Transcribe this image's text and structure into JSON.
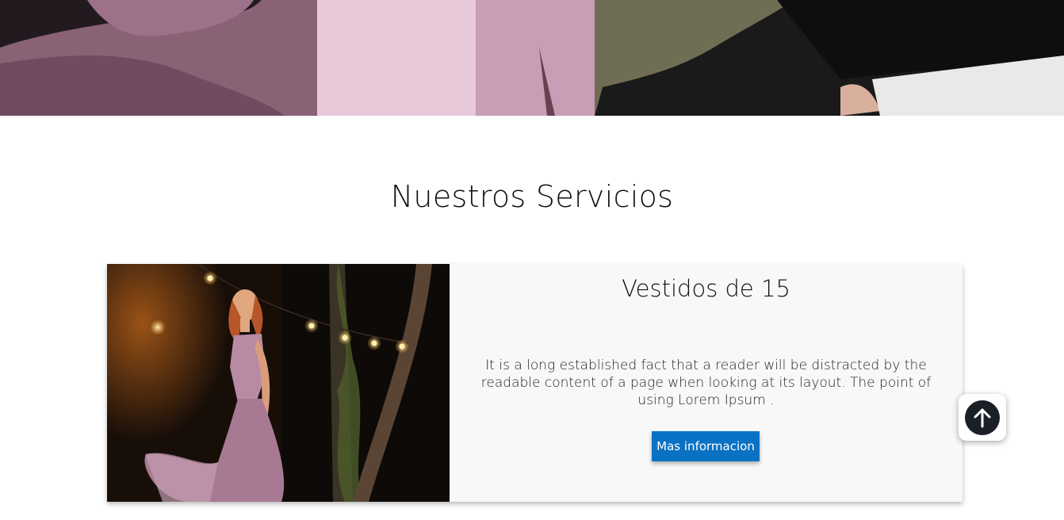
{
  "hero": {
    "image_alt": "banner-dresses-photo"
  },
  "services": {
    "title": "Nuestros Servicios",
    "cards": [
      {
        "image_alt": "quinceanera-dress-photo",
        "title": "Vestidos de 15",
        "text": "It is a long established fact that a reader will be distracted by the readable content of a page when looking at its layout. The point of using Lorem Ipsum .",
        "button_label": "Mas informacion"
      }
    ]
  },
  "scroll_top": {
    "icon": "arrow-up-icon"
  },
  "colors": {
    "button_bg": "#0a72c4",
    "card_bg": "#f8f8f8",
    "scroll_circle": "#1b1f26"
  }
}
